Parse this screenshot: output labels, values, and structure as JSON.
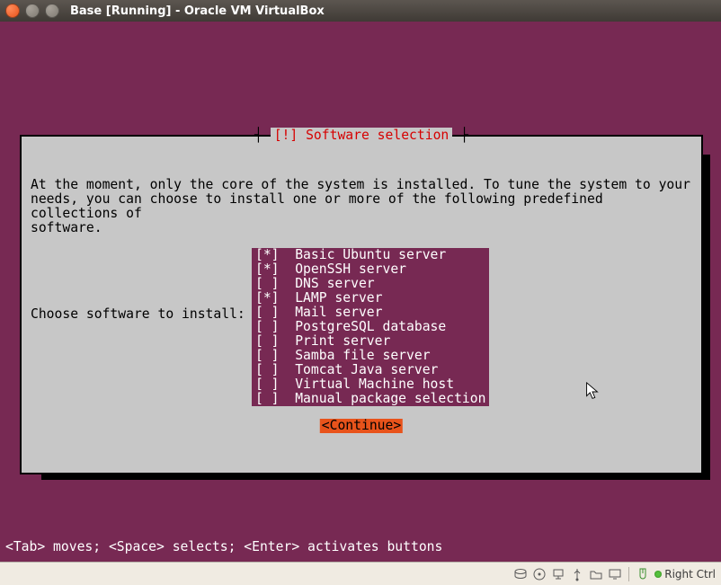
{
  "window": {
    "title": "Base [Running] - Oracle VM VirtualBox"
  },
  "dialog": {
    "title": "[!] Software selection",
    "intro": "At the moment, only the core of the system is installed. To tune the system to your\nneeds, you can choose to install one or more of the following predefined collections of\nsoftware.",
    "prompt": "Choose software to install:",
    "continue": "<Continue>"
  },
  "software": [
    {
      "checked": true,
      "label": "Basic Ubuntu server"
    },
    {
      "checked": true,
      "label": "OpenSSH server"
    },
    {
      "checked": false,
      "label": "DNS server"
    },
    {
      "checked": true,
      "label": "LAMP server"
    },
    {
      "checked": false,
      "label": "Mail server"
    },
    {
      "checked": false,
      "label": "PostgreSQL database"
    },
    {
      "checked": false,
      "label": "Print server"
    },
    {
      "checked": false,
      "label": "Samba file server"
    },
    {
      "checked": false,
      "label": "Tomcat Java server"
    },
    {
      "checked": false,
      "label": "Virtual Machine host"
    },
    {
      "checked": false,
      "label": "Manual package selection"
    }
  ],
  "hint": "<Tab> moves; <Space> selects; <Enter> activates buttons",
  "status": {
    "hostkey": "Right Ctrl"
  }
}
